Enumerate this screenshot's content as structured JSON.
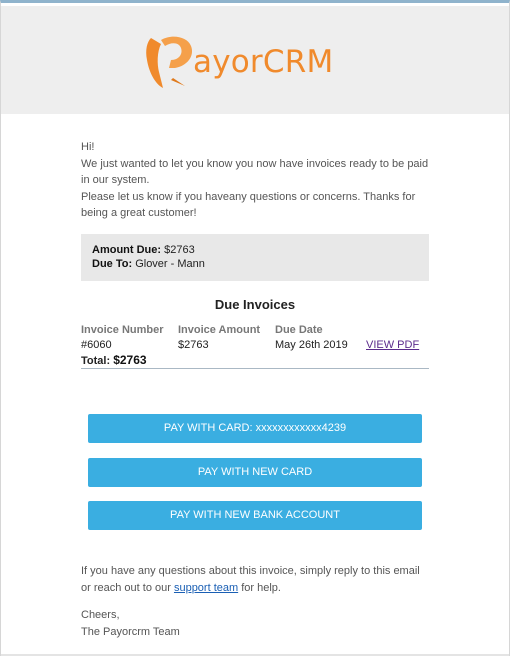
{
  "header": {
    "logo_text_part": "ayorCRM",
    "logo_color": "#f08a2c",
    "background": "#eeeeee"
  },
  "intro": {
    "greeting": "Hi!",
    "line1": "We just wanted to let you know you now have invoices ready to be paid in our system.",
    "line2": "Please let us know if you haveany questions or concerns. Thanks for being a great customer!"
  },
  "summary": {
    "amount_due_label": "Amount Due:",
    "amount_due_value": "$2763",
    "due_to_label": "Due To:",
    "due_to_value": "Glover - Mann"
  },
  "invoices": {
    "title": "Due Invoices",
    "columns": [
      "Invoice Number",
      "Invoice Amount",
      "Due Date"
    ],
    "rows": [
      {
        "number": "#6060",
        "amount": "$2763",
        "due_date": "May 26th 2019",
        "action": "VIEW PDF"
      }
    ],
    "total_label": "Total:",
    "total_value": "$2763"
  },
  "buttons": {
    "pay_card": "PAY WITH CARD: xxxxxxxxxxxx4239",
    "pay_new_card": "PAY WITH NEW CARD",
    "pay_new_bank": "PAY WITH NEW BANK ACCOUNT",
    "color": "#3aaee1"
  },
  "footer": {
    "text_before": "If you have any questions about this invoice, simply reply to this email or reach out to our ",
    "link": "support team",
    "text_after": " for help.",
    "signoff": "Cheers,",
    "team": "The Payorcrm Team"
  }
}
